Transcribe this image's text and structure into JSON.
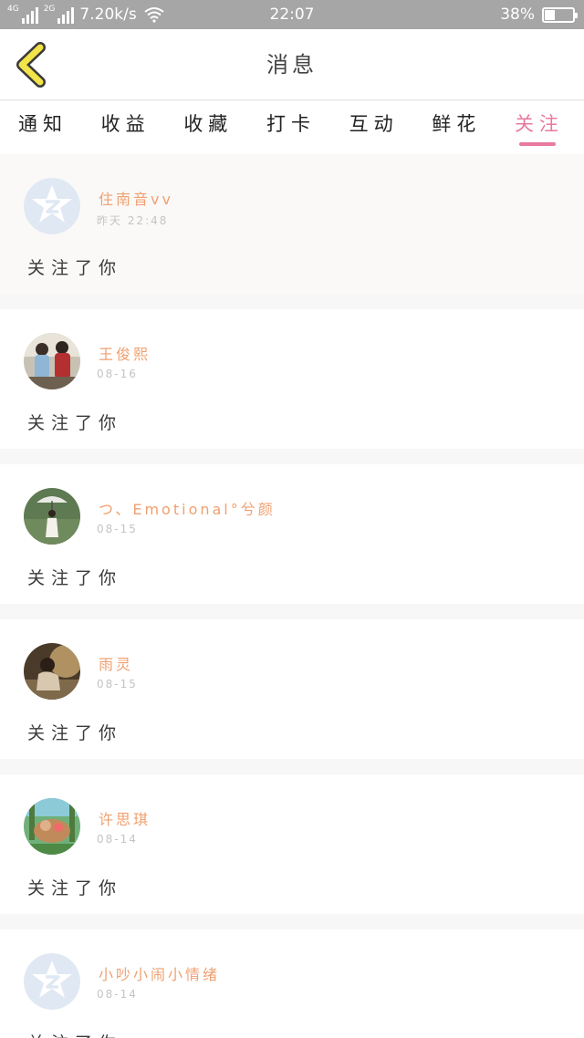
{
  "status_bar": {
    "net1": "4G",
    "net2": "2G",
    "speed": "7.20k/s",
    "time": "22:07",
    "battery_text": "38%",
    "battery_level": 0.38
  },
  "header": {
    "title": "消息",
    "back_icon": "chevron-left-icon"
  },
  "tabs": [
    {
      "label": "通知",
      "active": false
    },
    {
      "label": "收益",
      "active": false
    },
    {
      "label": "收藏",
      "active": false
    },
    {
      "label": "打卡",
      "active": false
    },
    {
      "label": "互动",
      "active": false
    },
    {
      "label": "鲜花",
      "active": false
    },
    {
      "label": "关注",
      "active": true
    }
  ],
  "messages": [
    {
      "name": "住南音vv",
      "date": "昨天 22:48",
      "action": "关注了你",
      "avatar": "default-qq-avatar"
    },
    {
      "name": "王俊熙",
      "date": "08-16",
      "action": "关注了你",
      "avatar": "photo-avatar-couple"
    },
    {
      "name": "つ、Emotional°兮颜",
      "date": "08-15",
      "action": "关注了你",
      "avatar": "photo-avatar-umbrella"
    },
    {
      "name": "雨灵",
      "date": "08-15",
      "action": "关注了你",
      "avatar": "photo-avatar-girl"
    },
    {
      "name": "许思琪",
      "date": "08-14",
      "action": "关注了你",
      "avatar": "cartoon-avatar"
    },
    {
      "name": "小吵小闹小情绪",
      "date": "08-14",
      "action": "关注了你",
      "avatar": "default-qq-avatar"
    }
  ],
  "colors": {
    "accent": "#e8799f",
    "name": "#f0a070",
    "back_arrow": "#f2e34a"
  }
}
